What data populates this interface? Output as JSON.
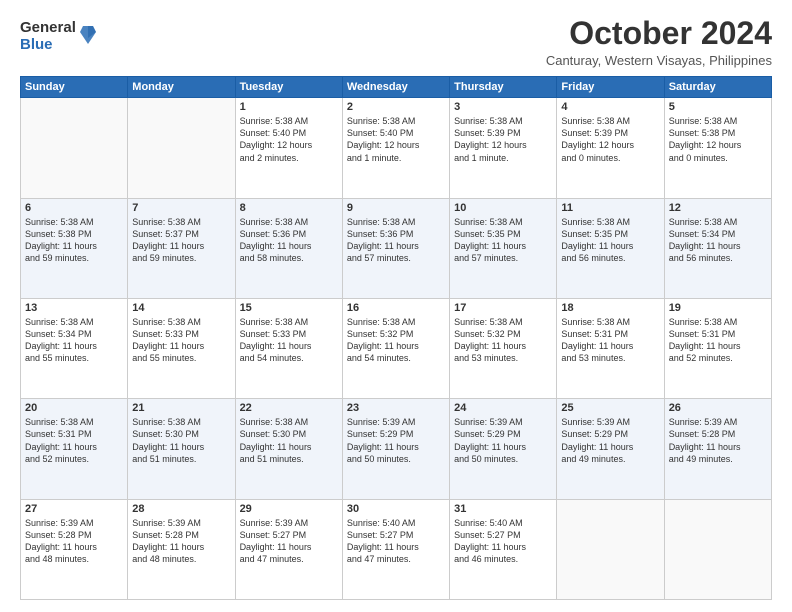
{
  "logo": {
    "general": "General",
    "blue": "Blue"
  },
  "title": "October 2024",
  "location": "Canturay, Western Visayas, Philippines",
  "days": [
    "Sunday",
    "Monday",
    "Tuesday",
    "Wednesday",
    "Thursday",
    "Friday",
    "Saturday"
  ],
  "weeks": [
    [
      {
        "day": "",
        "content": ""
      },
      {
        "day": "",
        "content": ""
      },
      {
        "day": "1",
        "content": "Sunrise: 5:38 AM\nSunset: 5:40 PM\nDaylight: 12 hours\nand 2 minutes."
      },
      {
        "day": "2",
        "content": "Sunrise: 5:38 AM\nSunset: 5:40 PM\nDaylight: 12 hours\nand 1 minute."
      },
      {
        "day": "3",
        "content": "Sunrise: 5:38 AM\nSunset: 5:39 PM\nDaylight: 12 hours\nand 1 minute."
      },
      {
        "day": "4",
        "content": "Sunrise: 5:38 AM\nSunset: 5:39 PM\nDaylight: 12 hours\nand 0 minutes."
      },
      {
        "day": "5",
        "content": "Sunrise: 5:38 AM\nSunset: 5:38 PM\nDaylight: 12 hours\nand 0 minutes."
      }
    ],
    [
      {
        "day": "6",
        "content": "Sunrise: 5:38 AM\nSunset: 5:38 PM\nDaylight: 11 hours\nand 59 minutes."
      },
      {
        "day": "7",
        "content": "Sunrise: 5:38 AM\nSunset: 5:37 PM\nDaylight: 11 hours\nand 59 minutes."
      },
      {
        "day": "8",
        "content": "Sunrise: 5:38 AM\nSunset: 5:36 PM\nDaylight: 11 hours\nand 58 minutes."
      },
      {
        "day": "9",
        "content": "Sunrise: 5:38 AM\nSunset: 5:36 PM\nDaylight: 11 hours\nand 57 minutes."
      },
      {
        "day": "10",
        "content": "Sunrise: 5:38 AM\nSunset: 5:35 PM\nDaylight: 11 hours\nand 57 minutes."
      },
      {
        "day": "11",
        "content": "Sunrise: 5:38 AM\nSunset: 5:35 PM\nDaylight: 11 hours\nand 56 minutes."
      },
      {
        "day": "12",
        "content": "Sunrise: 5:38 AM\nSunset: 5:34 PM\nDaylight: 11 hours\nand 56 minutes."
      }
    ],
    [
      {
        "day": "13",
        "content": "Sunrise: 5:38 AM\nSunset: 5:34 PM\nDaylight: 11 hours\nand 55 minutes."
      },
      {
        "day": "14",
        "content": "Sunrise: 5:38 AM\nSunset: 5:33 PM\nDaylight: 11 hours\nand 55 minutes."
      },
      {
        "day": "15",
        "content": "Sunrise: 5:38 AM\nSunset: 5:33 PM\nDaylight: 11 hours\nand 54 minutes."
      },
      {
        "day": "16",
        "content": "Sunrise: 5:38 AM\nSunset: 5:32 PM\nDaylight: 11 hours\nand 54 minutes."
      },
      {
        "day": "17",
        "content": "Sunrise: 5:38 AM\nSunset: 5:32 PM\nDaylight: 11 hours\nand 53 minutes."
      },
      {
        "day": "18",
        "content": "Sunrise: 5:38 AM\nSunset: 5:31 PM\nDaylight: 11 hours\nand 53 minutes."
      },
      {
        "day": "19",
        "content": "Sunrise: 5:38 AM\nSunset: 5:31 PM\nDaylight: 11 hours\nand 52 minutes."
      }
    ],
    [
      {
        "day": "20",
        "content": "Sunrise: 5:38 AM\nSunset: 5:31 PM\nDaylight: 11 hours\nand 52 minutes."
      },
      {
        "day": "21",
        "content": "Sunrise: 5:38 AM\nSunset: 5:30 PM\nDaylight: 11 hours\nand 51 minutes."
      },
      {
        "day": "22",
        "content": "Sunrise: 5:38 AM\nSunset: 5:30 PM\nDaylight: 11 hours\nand 51 minutes."
      },
      {
        "day": "23",
        "content": "Sunrise: 5:39 AM\nSunset: 5:29 PM\nDaylight: 11 hours\nand 50 minutes."
      },
      {
        "day": "24",
        "content": "Sunrise: 5:39 AM\nSunset: 5:29 PM\nDaylight: 11 hours\nand 50 minutes."
      },
      {
        "day": "25",
        "content": "Sunrise: 5:39 AM\nSunset: 5:29 PM\nDaylight: 11 hours\nand 49 minutes."
      },
      {
        "day": "26",
        "content": "Sunrise: 5:39 AM\nSunset: 5:28 PM\nDaylight: 11 hours\nand 49 minutes."
      }
    ],
    [
      {
        "day": "27",
        "content": "Sunrise: 5:39 AM\nSunset: 5:28 PM\nDaylight: 11 hours\nand 48 minutes."
      },
      {
        "day": "28",
        "content": "Sunrise: 5:39 AM\nSunset: 5:28 PM\nDaylight: 11 hours\nand 48 minutes."
      },
      {
        "day": "29",
        "content": "Sunrise: 5:39 AM\nSunset: 5:27 PM\nDaylight: 11 hours\nand 47 minutes."
      },
      {
        "day": "30",
        "content": "Sunrise: 5:40 AM\nSunset: 5:27 PM\nDaylight: 11 hours\nand 47 minutes."
      },
      {
        "day": "31",
        "content": "Sunrise: 5:40 AM\nSunset: 5:27 PM\nDaylight: 11 hours\nand 46 minutes."
      },
      {
        "day": "",
        "content": ""
      },
      {
        "day": "",
        "content": ""
      }
    ]
  ]
}
